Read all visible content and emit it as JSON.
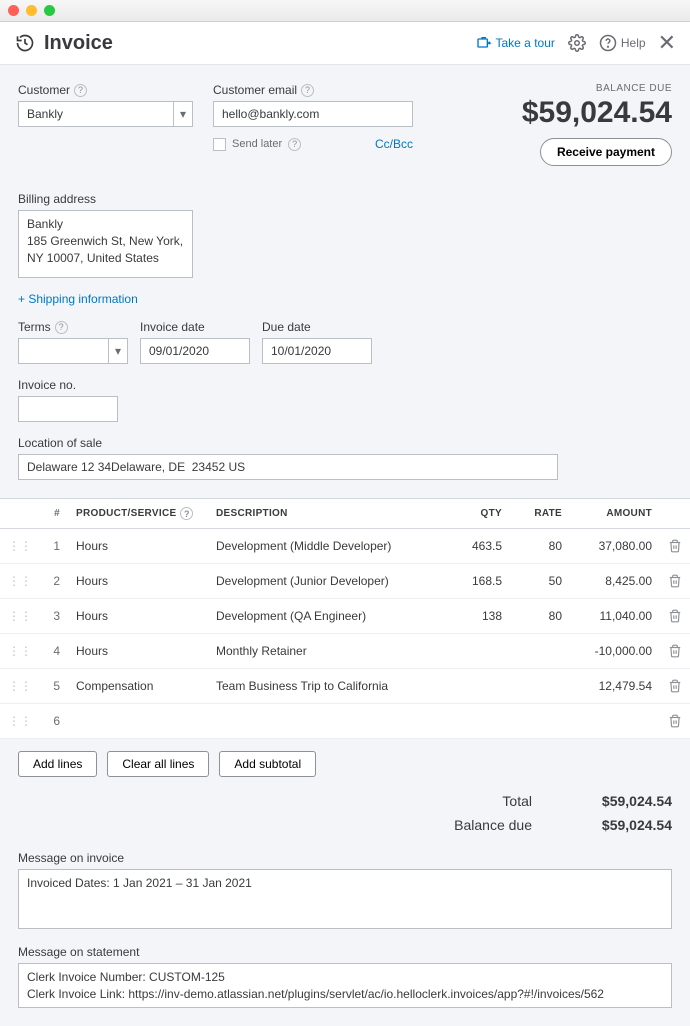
{
  "window": {
    "title": "Invoice"
  },
  "header": {
    "tour": "Take a tour",
    "help": "Help"
  },
  "balance": {
    "label": "BALANCE DUE",
    "amount": "$59,024.54",
    "receive_btn": "Receive payment"
  },
  "customer": {
    "label": "Customer",
    "value": "Bankly"
  },
  "email": {
    "label": "Customer email",
    "value": "hello@bankly.com",
    "send_later": "Send later",
    "ccbcc": "Cc/Bcc"
  },
  "billing": {
    "label": "Billing address",
    "value": "Bankly\n185 Greenwich St, New York, NY 10007, United States"
  },
  "shipping_link": "+ Shipping information",
  "terms": {
    "label": "Terms",
    "value": ""
  },
  "invoice_date": {
    "label": "Invoice date",
    "value": "09/01/2020"
  },
  "due_date": {
    "label": "Due date",
    "value": "10/01/2020"
  },
  "invoice_no": {
    "label": "Invoice no.",
    "value": ""
  },
  "location": {
    "label": "Location of sale",
    "value": "Delaware 12 34Delaware, DE  23452 US"
  },
  "table": {
    "headers": {
      "num": "#",
      "product": "PRODUCT/SERVICE",
      "description": "DESCRIPTION",
      "qty": "QTY",
      "rate": "RATE",
      "amount": "AMOUNT"
    },
    "rows": [
      {
        "n": "1",
        "product": "Hours",
        "desc": "Development (Middle Developer)",
        "qty": "463.5",
        "rate": "80",
        "amount": "37,080.00"
      },
      {
        "n": "2",
        "product": "Hours",
        "desc": "Development (Junior Developer)",
        "qty": "168.5",
        "rate": "50",
        "amount": "8,425.00"
      },
      {
        "n": "3",
        "product": "Hours",
        "desc": "Development (QA Engineer)",
        "qty": "138",
        "rate": "80",
        "amount": "11,040.00"
      },
      {
        "n": "4",
        "product": "Hours",
        "desc": "Monthly Retainer",
        "qty": "",
        "rate": "",
        "amount": "-10,000.00"
      },
      {
        "n": "5",
        "product": "Compensation",
        "desc": "Team Business Trip to California",
        "qty": "",
        "rate": "",
        "amount": "12,479.54"
      },
      {
        "n": "6",
        "product": "",
        "desc": "",
        "qty": "",
        "rate": "",
        "amount": ""
      }
    ]
  },
  "line_buttons": {
    "add": "Add lines",
    "clear": "Clear all lines",
    "subtotal": "Add subtotal"
  },
  "totals": {
    "total_label": "Total",
    "total_value": "$59,024.54",
    "balance_label": "Balance due",
    "balance_value": "$59,024.54"
  },
  "message_invoice": {
    "label": "Message on invoice",
    "value": "Invoiced Dates: 1 Jan 2021 – 31 Jan 2021"
  },
  "message_statement": {
    "label": "Message on statement",
    "value": "Clerk Invoice Number: CUSTOM-125\nClerk Invoice Link: https://inv-demo.atlassian.net/plugins/servlet/ac/io.helloclerk.invoices/app?#!/invoices/562"
  }
}
